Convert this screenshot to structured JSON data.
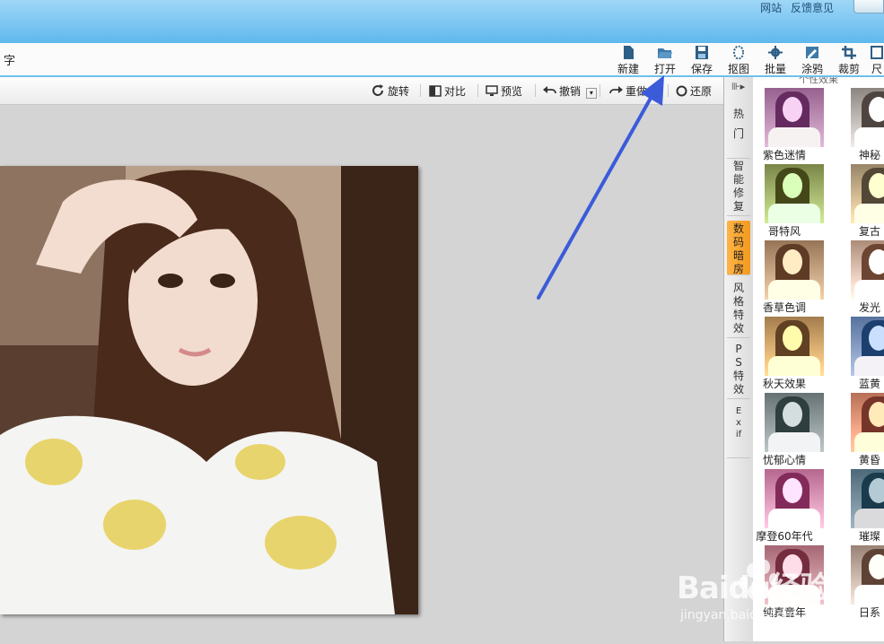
{
  "top_links": [
    "网站",
    "反馈意见"
  ],
  "mainbar": {
    "left_text": "字",
    "tools": [
      {
        "label": "新建",
        "icon": "new-file-icon"
      },
      {
        "label": "打开",
        "icon": "open-folder-icon"
      },
      {
        "label": "保存",
        "icon": "save-icon"
      },
      {
        "label": "抠图",
        "icon": "cutout-icon"
      },
      {
        "label": "批量",
        "icon": "batch-icon"
      },
      {
        "label": "涂鸦",
        "icon": "doodle-icon"
      },
      {
        "label": "裁剪",
        "icon": "crop-icon"
      },
      {
        "label": "尺",
        "icon": "resize-icon"
      }
    ]
  },
  "subbar": {
    "rotate": "旋转",
    "compare": "对比",
    "preview": "预览",
    "undo": "撤销",
    "redo": "重做",
    "restore": "还原"
  },
  "side_tabs": [
    "热门",
    "智能修复",
    "数码暗房",
    "风格特效",
    "PS特效",
    "Exif"
  ],
  "active_side_tab": "数码暗房",
  "effects_header": "个性效果",
  "effects": {
    "left": [
      "紫色迷情",
      "哥特风",
      "香草色调",
      "秋天效果",
      "忧郁心情",
      "摩登60年代",
      "纯真童年"
    ],
    "right": [
      "神秘",
      "复古",
      "发光",
      "蓝黄",
      "黄昏",
      "璀璨",
      "日系"
    ]
  },
  "watermark": {
    "brand": "Baidu经验",
    "url": "jingyan.baidu.com"
  },
  "colors": {
    "title_bar": "#5fb8ec",
    "accent_tab": "#f39a1e",
    "arrow": "#3b5bd9"
  }
}
